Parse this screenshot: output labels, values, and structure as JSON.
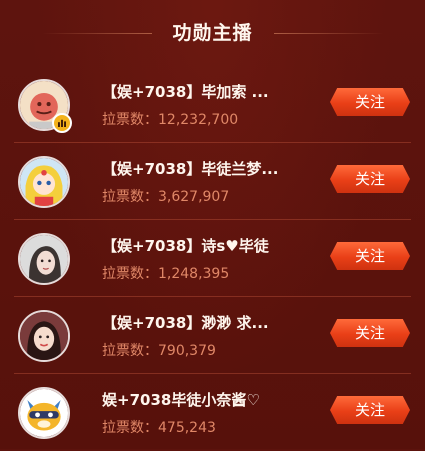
{
  "header": {
    "title": "功勋主播"
  },
  "follow_label": "关注",
  "votes_label": "拉票数：",
  "streamers": [
    {
      "name": "【娱+7038】毕加索 ...",
      "votes": "12,232,700",
      "avatar_icon": "cartoon-face-avatar",
      "badge_icon": "rank-bars-icon"
    },
    {
      "name": "【娱+7038】毕徒兰梦...",
      "votes": "3,627,907",
      "avatar_icon": "anime-girl-avatar"
    },
    {
      "name": "【娱+7038】诗s♥毕徒",
      "votes": "1,248,395",
      "avatar_icon": "girl-photo-avatar"
    },
    {
      "name": "【娱+7038】渺渺 求...",
      "votes": "790,379",
      "avatar_icon": "girl-photo-avatar"
    },
    {
      "name": "娱+7038毕徒小奈酱♡",
      "votes": "475,243",
      "avatar_icon": "raccoon-mascot-avatar"
    }
  ],
  "colors": {
    "background": "#5c130d",
    "votes_text": "#e08767",
    "follow_button": "#e93f17",
    "badge": "#f3b21c"
  }
}
